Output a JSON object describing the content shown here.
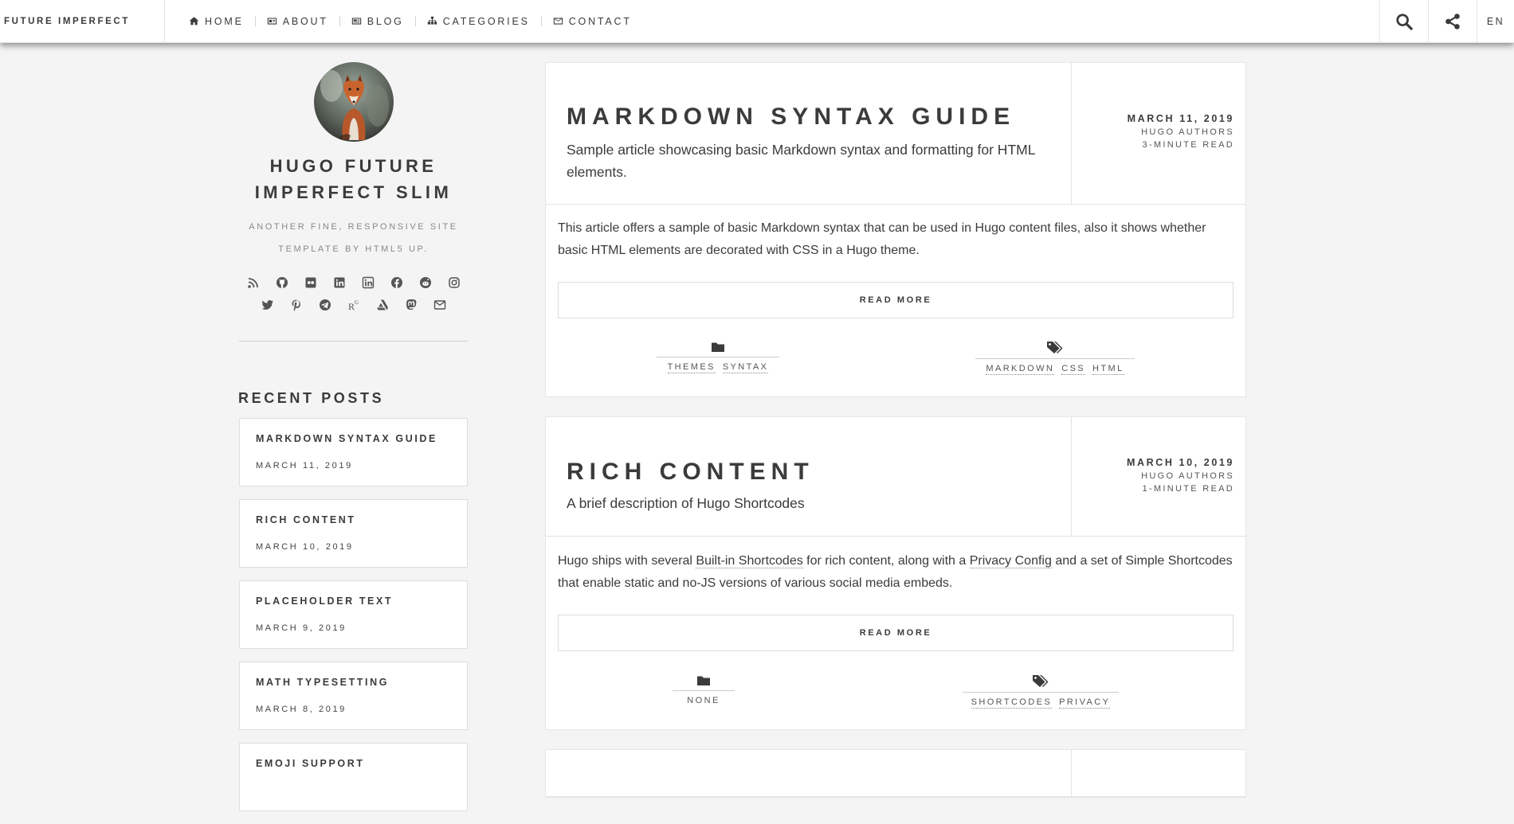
{
  "header": {
    "brand": "FUTURE IMPERFECT",
    "nav": [
      {
        "label": "HOME",
        "icon": "home-icon"
      },
      {
        "label": "ABOUT",
        "icon": "id-card-icon"
      },
      {
        "label": "BLOG",
        "icon": "newspaper-icon"
      },
      {
        "label": "CATEGORIES",
        "icon": "sitemap-icon"
      },
      {
        "label": "CONTACT",
        "icon": "envelope-icon"
      }
    ],
    "language": "EN"
  },
  "sidebar": {
    "title": "HUGO FUTURE IMPERFECT SLIM",
    "description": "ANOTHER FINE, RESPONSIVE SITE TEMPLATE BY HTML5 UP.",
    "social_row1": [
      "rss-icon",
      "github-icon",
      "flickr-icon",
      "linkedin-icon",
      "linkedin-square-icon",
      "facebook-icon",
      "reddit-icon",
      "instagram-icon"
    ],
    "social_row2": [
      "twitter-icon",
      "pinterest-icon",
      "telegram-icon",
      "researchgate-icon",
      "artstation-icon",
      "mastodon-icon",
      "envelope-icon"
    ],
    "recent_heading": "RECENT POSTS",
    "recent_posts": [
      {
        "title": "MARKDOWN SYNTAX GUIDE",
        "date": "MARCH 11, 2019"
      },
      {
        "title": "RICH CONTENT",
        "date": "MARCH 10, 2019"
      },
      {
        "title": "PLACEHOLDER TEXT",
        "date": "MARCH 9, 2019"
      },
      {
        "title": "MATH TYPESETTING",
        "date": "MARCH 8, 2019"
      },
      {
        "title": "EMOJI SUPPORT",
        "date": ""
      }
    ]
  },
  "posts": [
    {
      "title": "MARKDOWN SYNTAX GUIDE",
      "subtitle": "Sample article showcasing basic Markdown syntax and formatting for HTML elements.",
      "date": "MARCH 11, 2019",
      "author": "HUGO AUTHORS",
      "read_time": "3-MINUTE READ",
      "excerpt": "This article offers a sample of basic Markdown syntax that can be used in Hugo content files, also it shows whether basic HTML elements are decorated with CSS in a Hugo theme.",
      "read_more": "READ MORE",
      "categories": [
        "THEMES",
        "SYNTAX"
      ],
      "tags": [
        "MARKDOWN",
        "CSS",
        "HTML"
      ]
    },
    {
      "title": "RICH CONTENT",
      "subtitle": "A brief description of Hugo Shortcodes",
      "date": "MARCH 10, 2019",
      "author": "HUGO AUTHORS",
      "read_time": "1-MINUTE READ",
      "excerpt_parts": [
        "Hugo ships with several ",
        "Built-in Shortcodes",
        " for rich content, along with a ",
        "Privacy Config",
        " and a set of Simple Shortcodes that enable static and no-JS versions of various social media embeds."
      ],
      "read_more": "READ MORE",
      "categories": [
        "NONE"
      ],
      "tags": [
        "SHORTCODES",
        "PRIVACY"
      ]
    }
  ]
}
